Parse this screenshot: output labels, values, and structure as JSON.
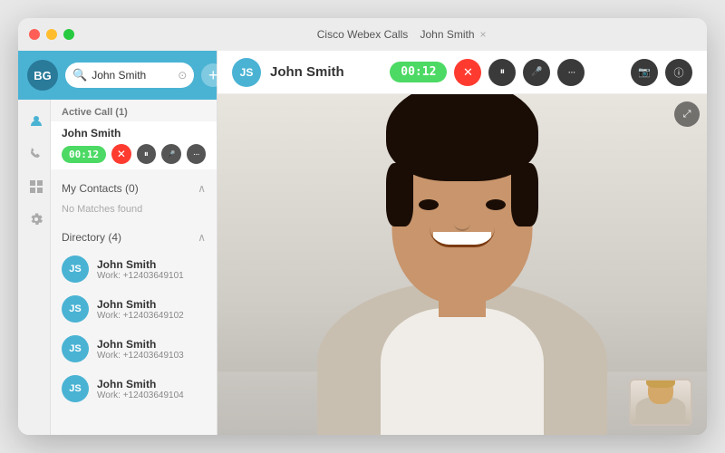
{
  "window": {
    "title": "Cisco Webex Calls",
    "tab_title": "John Smith",
    "tab_close": "×"
  },
  "sidebar": {
    "user_initials": "BG",
    "search_value": "John Smith",
    "add_btn": "+",
    "nav_icons": [
      {
        "name": "contacts-icon",
        "symbol": "👤",
        "active": true
      },
      {
        "name": "calls-icon",
        "symbol": "📞",
        "active": false
      },
      {
        "name": "grid-icon",
        "symbol": "⣿",
        "active": false
      },
      {
        "name": "settings-icon",
        "symbol": "⚙",
        "active": false
      }
    ]
  },
  "active_call": {
    "section_label": "Active Call (1)",
    "name": "John Smith",
    "timer": "00:12",
    "controls": {
      "end": "×",
      "hold": "⏸",
      "mute": "🎤",
      "more": "···"
    }
  },
  "my_contacts": {
    "label": "My Contacts (0)",
    "no_matches": "No Matches found"
  },
  "directory": {
    "label": "Directory (4)",
    "items": [
      {
        "initials": "JS",
        "name": "John Smith",
        "phone": "Work: +12403649101"
      },
      {
        "initials": "JS",
        "name": "John Smith",
        "phone": "Work: +12403649102"
      },
      {
        "initials": "JS",
        "name": "John Smith",
        "phone": "Work: +12403649103"
      },
      {
        "initials": "JS",
        "name": "John Smith",
        "phone": "Work: +12403649104"
      }
    ]
  },
  "call_header": {
    "avatar_initials": "JS",
    "name": "John Smith",
    "timer": "00:12",
    "end_icon": "×",
    "hold_icon": "⏸",
    "mute_icon": "🎤",
    "more_icon": "···",
    "video_icon": "📷",
    "info_icon": "ⓘ"
  },
  "video": {
    "expand_icon": "⤢",
    "cam_icon": "🎥"
  }
}
